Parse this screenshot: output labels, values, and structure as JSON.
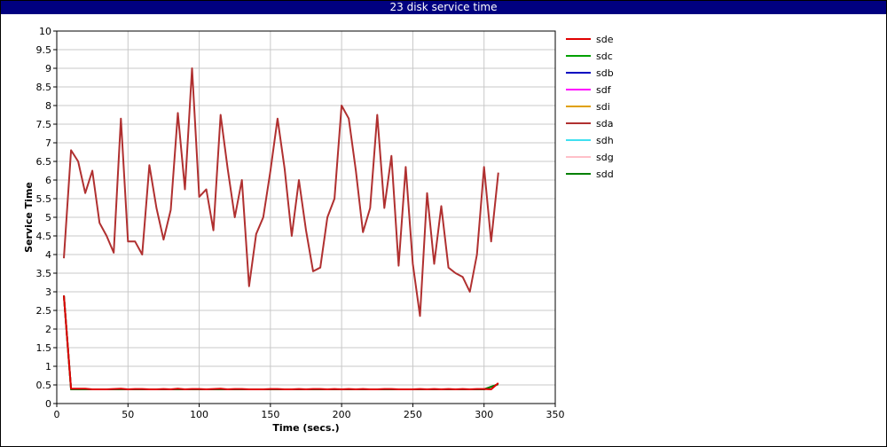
{
  "window": {
    "title": "23 disk service time"
  },
  "chart_data": {
    "type": "line",
    "xlabel": "Time (secs.)",
    "ylabel": "Service Time",
    "xlim": [
      0,
      350
    ],
    "ylim": [
      0,
      10
    ],
    "xticks": [
      0,
      50,
      100,
      150,
      200,
      250,
      300,
      350
    ],
    "yticks": [
      0,
      0.5,
      1,
      1.5,
      2,
      2.5,
      3,
      3.5,
      4,
      4.5,
      5,
      5.5,
      6,
      6.5,
      7,
      7.5,
      8,
      8.5,
      9,
      9.5,
      10
    ],
    "grid": true,
    "legend_position": "right",
    "series": [
      {
        "name": "sde",
        "color": "#e00000",
        "x": [
          5,
          10,
          15,
          20,
          25,
          30,
          35,
          40,
          45,
          50,
          55,
          60,
          65,
          70,
          75,
          80,
          85,
          90,
          95,
          100,
          105,
          110,
          115,
          120,
          125,
          130,
          135,
          140,
          145,
          150,
          155,
          160,
          165,
          170,
          175,
          180,
          185,
          190,
          195,
          200,
          205,
          210,
          215,
          220,
          225,
          230,
          235,
          240,
          245,
          250,
          255,
          260,
          265,
          270,
          275,
          280,
          285,
          290,
          295,
          300,
          305,
          310
        ],
        "y": [
          2.9,
          0.4,
          0.4,
          0.4,
          0.38,
          0.38,
          0.38,
          0.39,
          0.4,
          0.38,
          0.39,
          0.39,
          0.38,
          0.38,
          0.39,
          0.38,
          0.4,
          0.38,
          0.39,
          0.39,
          0.38,
          0.39,
          0.4,
          0.38,
          0.39,
          0.39,
          0.38,
          0.38,
          0.38,
          0.39,
          0.39,
          0.38,
          0.38,
          0.39,
          0.38,
          0.39,
          0.39,
          0.38,
          0.39,
          0.38,
          0.39,
          0.38,
          0.39,
          0.38,
          0.38,
          0.39,
          0.39,
          0.38,
          0.38,
          0.38,
          0.39,
          0.38,
          0.39,
          0.38,
          0.39,
          0.38,
          0.39,
          0.38,
          0.39,
          0.39,
          0.38,
          0.55
        ]
      },
      {
        "name": "sdc",
        "color": "#00a000",
        "x": [
          5,
          10,
          50,
          100,
          150,
          200,
          250,
          300,
          310
        ],
        "y": [
          2.9,
          0.38,
          0.38,
          0.38,
          0.38,
          0.38,
          0.38,
          0.38,
          0.52
        ]
      },
      {
        "name": "sdb",
        "color": "#0000c0",
        "x": [
          5,
          10,
          50,
          100,
          150,
          200,
          250,
          300,
          310
        ],
        "y": [
          2.9,
          0.38,
          0.38,
          0.38,
          0.38,
          0.38,
          0.38,
          0.38,
          0.52
        ]
      },
      {
        "name": "sdf",
        "color": "#ff00ff",
        "x": [
          5,
          10,
          50,
          100,
          150,
          200,
          250,
          300,
          310
        ],
        "y": [
          2.9,
          0.38,
          0.38,
          0.38,
          0.38,
          0.38,
          0.38,
          0.38,
          0.52
        ]
      },
      {
        "name": "sdi",
        "color": "#e0a000",
        "x": [
          5,
          10,
          50,
          100,
          150,
          200,
          250,
          300,
          310
        ],
        "y": [
          2.9,
          0.38,
          0.38,
          0.38,
          0.38,
          0.38,
          0.38,
          0.38,
          0.52
        ]
      },
      {
        "name": "sda",
        "color": "#b03030",
        "x": [
          5,
          10,
          15,
          20,
          25,
          30,
          35,
          40,
          45,
          50,
          55,
          60,
          65,
          70,
          75,
          80,
          85,
          90,
          95,
          100,
          105,
          110,
          115,
          120,
          125,
          130,
          135,
          140,
          145,
          150,
          155,
          160,
          165,
          170,
          175,
          180,
          185,
          190,
          195,
          200,
          205,
          210,
          215,
          220,
          225,
          230,
          235,
          240,
          245,
          250,
          255,
          260,
          265,
          270,
          275,
          280,
          285,
          290,
          295,
          300,
          305,
          310
        ],
        "y": [
          3.9,
          6.8,
          6.5,
          5.65,
          6.25,
          4.85,
          4.5,
          4.05,
          7.65,
          4.35,
          4.35,
          4.0,
          6.4,
          5.25,
          4.4,
          5.2,
          7.8,
          5.75,
          9.0,
          5.55,
          5.75,
          4.65,
          7.75,
          6.3,
          5.0,
          6.0,
          3.15,
          4.55,
          5.0,
          6.25,
          7.65,
          6.3,
          4.5,
          6.0,
          4.65,
          3.55,
          3.65,
          5.0,
          5.5,
          8.0,
          7.65,
          6.25,
          4.6,
          5.25,
          7.75,
          5.25,
          6.65,
          3.7,
          6.35,
          3.75,
          2.35,
          5.65,
          3.75,
          5.3,
          3.65,
          3.5,
          3.4,
          3.0,
          4.0,
          6.35,
          4.35,
          6.2
        ]
      },
      {
        "name": "sdh",
        "color": "#40e0f0",
        "x": [
          5,
          10,
          50,
          100,
          150,
          200,
          250,
          300,
          310
        ],
        "y": [
          2.9,
          0.38,
          0.38,
          0.38,
          0.38,
          0.38,
          0.38,
          0.38,
          0.52
        ]
      },
      {
        "name": "sdg",
        "color": "#ffc0c8",
        "x": [
          5,
          10,
          50,
          100,
          150,
          200,
          250,
          300,
          310
        ],
        "y": [
          2.9,
          0.38,
          0.38,
          0.38,
          0.38,
          0.38,
          0.38,
          0.38,
          0.52
        ]
      },
      {
        "name": "sdd",
        "color": "#008000",
        "x": [
          5,
          10,
          50,
          100,
          150,
          200,
          250,
          300,
          310
        ],
        "y": [
          2.9,
          0.38,
          0.38,
          0.38,
          0.38,
          0.38,
          0.38,
          0.38,
          0.52
        ]
      }
    ]
  }
}
